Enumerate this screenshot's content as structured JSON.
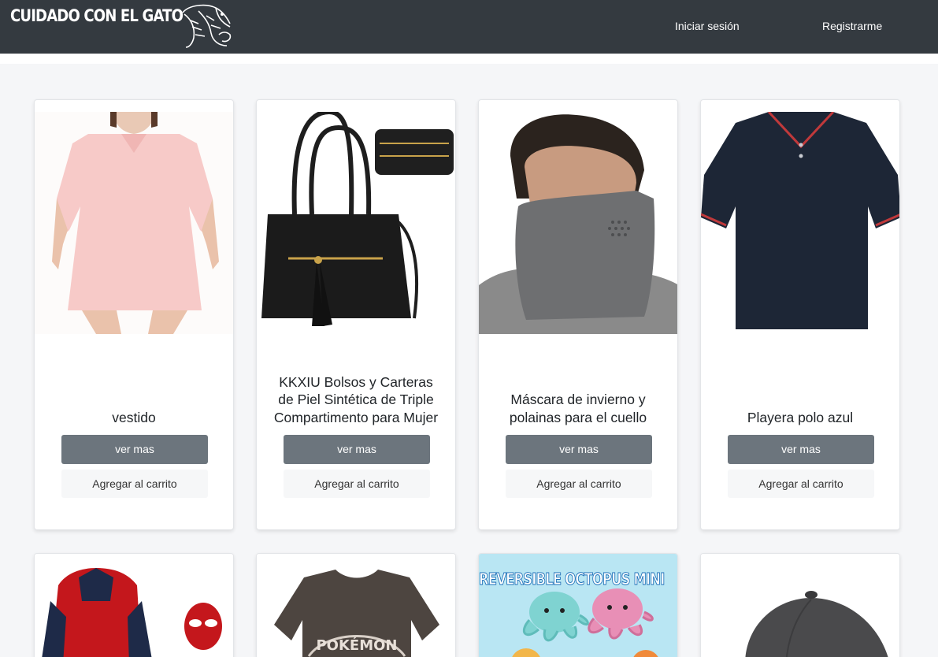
{
  "brand": {
    "name": "CUIDADO CON EL GATO",
    "logo_icon": "tiger-icon"
  },
  "nav": {
    "login": "Iniciar sesión",
    "register": "Registrarme"
  },
  "products": [
    {
      "title": "vestido",
      "more": "ver mas",
      "cart": "Agregar al carrito",
      "image": "pink-dress-image"
    },
    {
      "title": "KKXIU Bolsos y Carteras de Piel Sintética de Triple Compartimento para Mujer",
      "more": "ver mas",
      "cart": "Agregar al carrito",
      "image": "black-handbag-image"
    },
    {
      "title": "Máscara de invierno y polainas para el cuello",
      "more": "ver mas",
      "cart": "Agregar al carrito",
      "image": "neck-gaiter-image"
    },
    {
      "title": "Playera polo azul",
      "more": "ver mas",
      "cart": "Agregar al carrito",
      "image": "navy-polo-image"
    },
    {
      "image": "spiderman-costume-image"
    },
    {
      "image": "pokemon-shirt-image",
      "image_text": "POKÉMON"
    },
    {
      "image": "octopus-plush-image",
      "banner": "REVERSIBLE OCTOPUS MINI"
    },
    {
      "image": "gray-cap-image"
    }
  ],
  "colors": {
    "navbar": "#343a40",
    "button_primary": "#6c757d",
    "button_light": "#f6f7f8",
    "background": "#f5f6f8"
  }
}
